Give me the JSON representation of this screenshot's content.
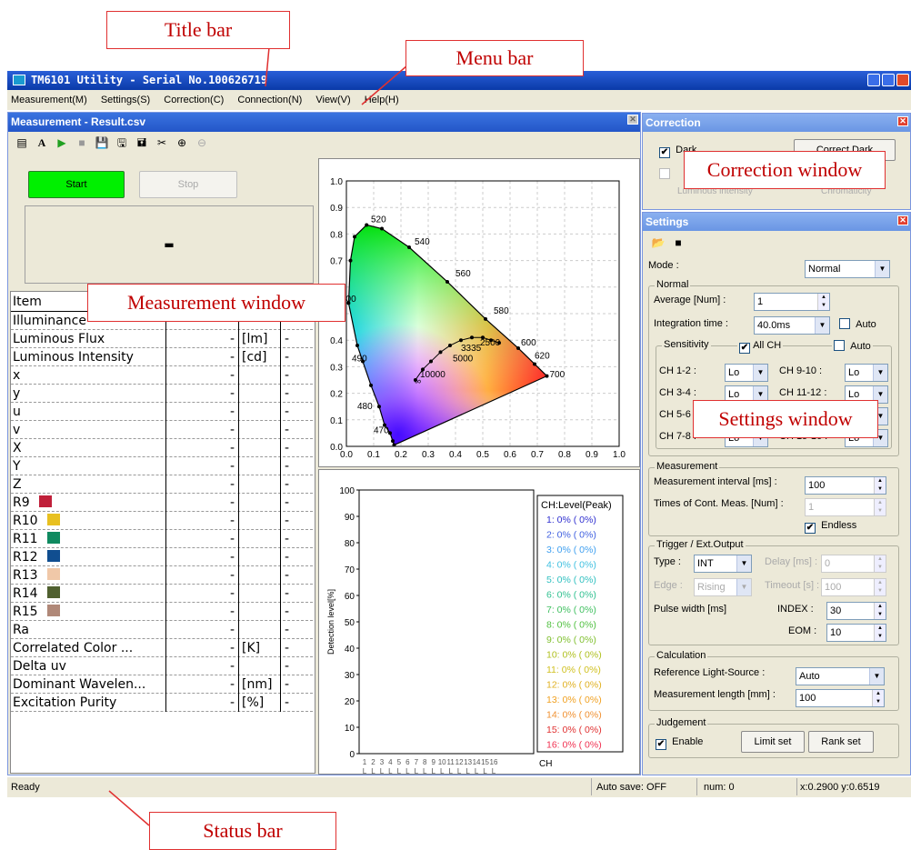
{
  "callouts": {
    "title_bar": "Title bar",
    "menu_bar": "Menu bar",
    "measurement_window": "Measurement window",
    "correction_window": "Correction window",
    "settings_window": "Settings window",
    "status_bar": "Status bar"
  },
  "window": {
    "title": "TM6101 Utility - Serial No.100626719"
  },
  "menu": [
    "Measurement(M)",
    "Settings(S)",
    "Correction(C)",
    "Connection(N)",
    "View(V)",
    "Help(H)"
  ],
  "measurement": {
    "header": "Measurement - Result.csv",
    "start_label": "Start",
    "stop_label": "Stop",
    "display_value": "-",
    "table": {
      "header": "Item",
      "rows": [
        {
          "item": "Illuminance",
          "value": "",
          "unit": "",
          "judge": ""
        },
        {
          "item": "Luminous Flux",
          "value": "-",
          "unit": "[lm]",
          "judge": "-"
        },
        {
          "item": "Luminous Intensity",
          "value": "-",
          "unit": "[cd]",
          "judge": "-"
        },
        {
          "item": "x",
          "value": "-",
          "unit": "",
          "judge": "-"
        },
        {
          "item": "y",
          "value": "-",
          "unit": "",
          "judge": "-"
        },
        {
          "item": "u",
          "value": "-",
          "unit": "",
          "judge": "-"
        },
        {
          "item": "v",
          "value": "-",
          "unit": "",
          "judge": "-"
        },
        {
          "item": "X",
          "value": "-",
          "unit": "",
          "judge": "-"
        },
        {
          "item": "Y",
          "value": "-",
          "unit": "",
          "judge": "-"
        },
        {
          "item": "Z",
          "value": "-",
          "unit": "",
          "judge": "-"
        },
        {
          "item": "R9",
          "value": "-",
          "unit": "",
          "judge": "-",
          "color": "#c0203a"
        },
        {
          "item": "R10",
          "value": "-",
          "unit": "",
          "judge": "-",
          "color": "#e8c020"
        },
        {
          "item": "R11",
          "value": "-",
          "unit": "",
          "judge": "-",
          "color": "#108a60"
        },
        {
          "item": "R12",
          "value": "-",
          "unit": "",
          "judge": "-",
          "color": "#104e90"
        },
        {
          "item": "R13",
          "value": "-",
          "unit": "",
          "judge": "-",
          "color": "#f0c8a8"
        },
        {
          "item": "R14",
          "value": "-",
          "unit": "",
          "judge": "-",
          "color": "#506030"
        },
        {
          "item": "R15",
          "value": "-",
          "unit": "",
          "judge": "-",
          "color": "#b08878"
        },
        {
          "item": "Ra",
          "value": "-",
          "unit": "",
          "judge": "-"
        },
        {
          "item": "Correlated Color ...",
          "value": "-",
          "unit": "[K]",
          "judge": "-"
        },
        {
          "item": "Delta uv",
          "value": "-",
          "unit": "",
          "judge": "-"
        },
        {
          "item": "Dominant Wavelen...",
          "value": "-",
          "unit": "[nm]",
          "judge": "-"
        },
        {
          "item": "Excitation Purity",
          "value": "-",
          "unit": "[%]",
          "judge": "-"
        }
      ]
    },
    "cie": {
      "y_ticks": [
        "1.0",
        "0.9",
        "0.8",
        "0.7",
        "0.6",
        "0.5",
        "0.4",
        "0.3",
        "0.2",
        "0.1",
        "0.0"
      ],
      "x_ticks": [
        "0.0",
        "0.1",
        "0.2",
        "0.3",
        "0.4",
        "0.5",
        "0.6",
        "0.7",
        "0.8",
        "0.9",
        "1.0"
      ],
      "wavelength_labels": [
        "520",
        "540",
        "560",
        "580",
        "600",
        "620",
        "700",
        "500",
        "490",
        "480",
        "470"
      ],
      "temperature_labels": [
        "3335",
        "2500",
        "5000",
        "10000",
        "∞"
      ]
    },
    "bar": {
      "ylabel": "Detection level[%]",
      "y_ticks": [
        "100",
        "90",
        "80",
        "70",
        "60",
        "50",
        "40",
        "30",
        "20",
        "10",
        "0"
      ],
      "x_unit": "CH",
      "legend_title": "CH:Level(Peak)",
      "channels": [
        {
          "text": "1: 0% ( 0%)",
          "color": "#3030d0"
        },
        {
          "text": "2: 0% ( 0%)",
          "color": "#4060e0"
        },
        {
          "text": "3: 0% ( 0%)",
          "color": "#40a0f0"
        },
        {
          "text": "4: 0% ( 0%)",
          "color": "#40c0e0"
        },
        {
          "text": "5: 0% ( 0%)",
          "color": "#30c0c0"
        },
        {
          "text": "6: 0% ( 0%)",
          "color": "#30c090"
        },
        {
          "text": "7: 0% ( 0%)",
          "color": "#40c060"
        },
        {
          "text": "8: 0% ( 0%)",
          "color": "#50c040"
        },
        {
          "text": "9: 0% ( 0%)",
          "color": "#80c030"
        },
        {
          "text": "10: 0% ( 0%)",
          "color": "#b0c020"
        },
        {
          "text": "11: 0% ( 0%)",
          "color": "#d0c020"
        },
        {
          "text": "12: 0% ( 0%)",
          "color": "#e0b020"
        },
        {
          "text": "13: 0% ( 0%)",
          "color": "#f0a020"
        },
        {
          "text": "14: 0% ( 0%)",
          "color": "#f09030"
        },
        {
          "text": "15: 0% ( 0%)",
          "color": "#e03030"
        },
        {
          "text": "16: 0% ( 0%)",
          "color": "#f03050"
        }
      ],
      "x_ticks": [
        "1",
        "2",
        "3",
        "4",
        "5",
        "6",
        "7",
        "8",
        "9",
        "10",
        "11",
        "12",
        "13",
        "14",
        "15",
        "16"
      ]
    }
  },
  "correction": {
    "header": "Correction",
    "dark_label": "Dark",
    "correct_dark_label": "Correct Dark",
    "luminous_intensity_label": "Luminous intensity",
    "chromaticity_label": "Chromaticity"
  },
  "settings": {
    "header": "Settings",
    "mode_label": "Mode :",
    "mode_value": "Normal",
    "normal_group": "Normal",
    "average_label": "Average [Num] :",
    "average_value": "1",
    "integration_label": "Integration time :",
    "integration_value": "40.0ms",
    "auto_label": "Auto",
    "sensitivity_group": "Sensitivity",
    "all_ch_label": "All CH",
    "ch": [
      {
        "label": "CH 1-2 :",
        "value": "Lo"
      },
      {
        "label": "CH 3-4 :",
        "value": "Lo"
      },
      {
        "label": "CH 5-6 :",
        "value": "Lo"
      },
      {
        "label": "CH 7-8 :",
        "value": "Lo"
      },
      {
        "label": "CH 9-10 :",
        "value": "Lo"
      },
      {
        "label": "CH 11-12 :",
        "value": "Lo"
      },
      {
        "label": "CH 13-14 :",
        "value": "Lo"
      },
      {
        "label": "CH 15-16 :",
        "value": "Lo"
      }
    ],
    "measurement_group": "Measurement",
    "interval_label": "Measurement interval [ms] :",
    "interval_value": "100",
    "times_label": "Times of Cont. Meas. [Num] :",
    "times_value": "1",
    "endless_label": "Endless",
    "trigger_group": "Trigger / Ext.Output",
    "type_label": "Type :",
    "type_value": "INT",
    "delay_label": "Delay [ms] :",
    "delay_value": "0",
    "edge_label": "Edge :",
    "edge_value": "Rising",
    "timeout_label": "Timeout [s] :",
    "timeout_value": "100",
    "pulse_label": "Pulse width [ms]",
    "index_label": "INDEX :",
    "index_value": "30",
    "eom_label": "EOM :",
    "eom_value": "10",
    "calc_group": "Calculation",
    "ref_label": "Reference Light-Source :",
    "ref_value": "Auto",
    "length_label": "Measurement length [mm] :",
    "length_value": "100",
    "judge_group": "Judgement",
    "enable_label": "Enable",
    "limit_label": "Limit set",
    "rank_label": "Rank set"
  },
  "status": {
    "ready": "Ready",
    "autosave": "Auto save: OFF",
    "num": "num: 0",
    "coords": "x:0.2900 y:0.6519"
  }
}
